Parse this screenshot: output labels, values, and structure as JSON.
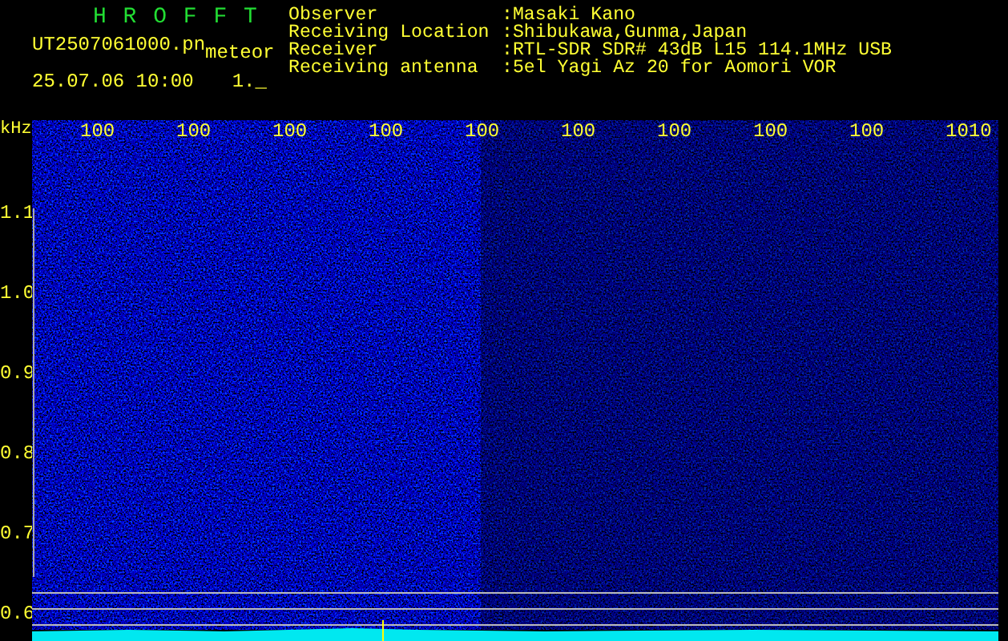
{
  "header": {
    "title": "H R O F F T",
    "file_name": "UT2507061000.pn",
    "file_suffix": "meteor",
    "date_time": "25.07.06 10:00",
    "counter": "1._"
  },
  "info": [
    {
      "label": "Observer",
      "value": ":Masaki Kano"
    },
    {
      "label": "Receiving Location",
      "value": ":Shibukawa,Gunma,Japan"
    },
    {
      "label": "Receiver",
      "value": ":RTL-SDR SDR# 43dB L15 114.1MHz USB"
    },
    {
      "label": "Receiving antenna",
      "value": ":5el Yagi Az 20 for Aomori VOR"
    }
  ],
  "spectrogram": {
    "y_unit": "kHz",
    "x_labels": [
      "100",
      "100",
      "100",
      "100",
      "100",
      "100",
      "100",
      "100",
      "100",
      "1010"
    ],
    "y_labels": [
      "1.1",
      "1.0",
      "0.9",
      "0.8",
      "0.7",
      "0.6"
    ]
  }
}
